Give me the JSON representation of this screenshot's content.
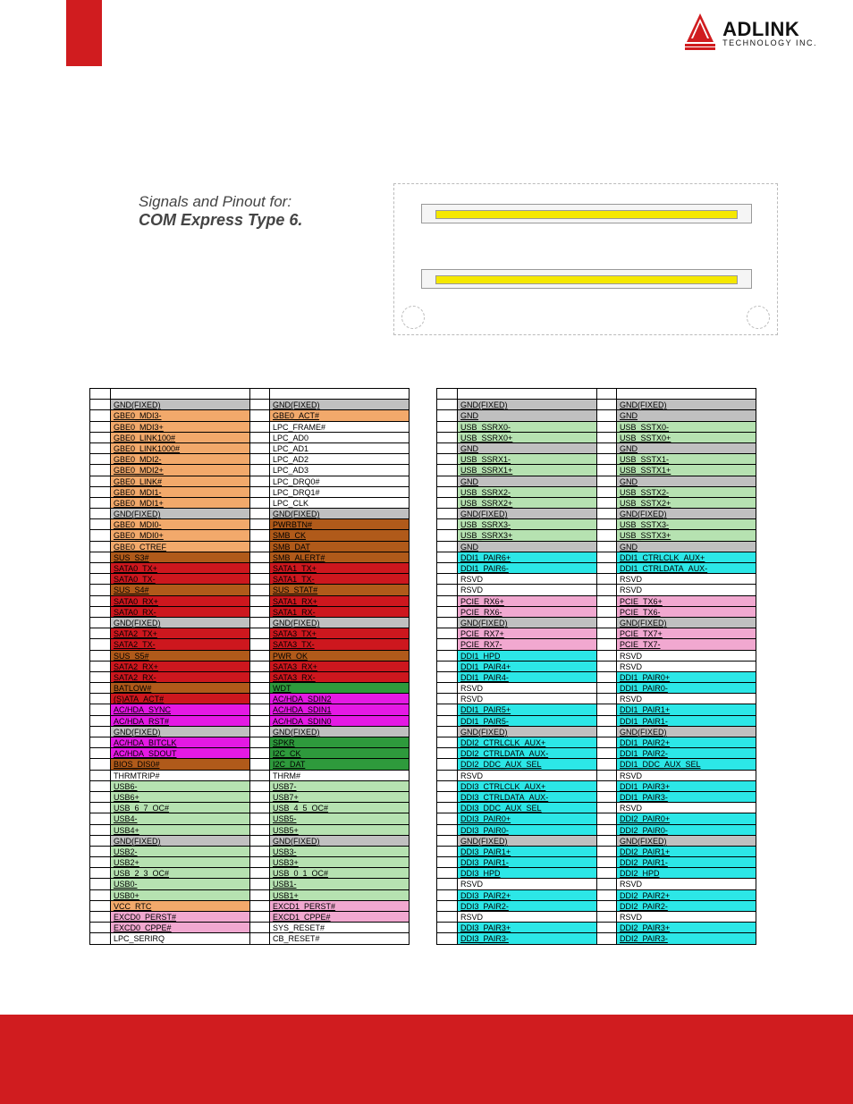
{
  "logo": {
    "main": "ADLINK",
    "sub": "TECHNOLOGY INC."
  },
  "title": {
    "line1": "Signals and Pinout for:",
    "line2": "COM Express Type 6."
  },
  "colors": {
    "gray": "#c0c0c0",
    "orange": "#f2a96b",
    "brown": "#b05a1a",
    "red": "#cd171e",
    "magenta": "#e419e4",
    "green": "#2e9a3c",
    "lgreen": "#b6e2b1",
    "pink": "#f1a8d0",
    "cyan": "#2ce7e7",
    "white": "#ffffff"
  },
  "columns": {
    "A": [
      {
        "sig": "",
        "c": "white"
      },
      {
        "sig": "GND(FIXED)",
        "c": "gray"
      },
      {
        "sig": "GBE0_MDI3-",
        "c": "orange"
      },
      {
        "sig": "GBE0_MDI3+",
        "c": "orange"
      },
      {
        "sig": "GBE0_LINK100#",
        "c": "orange"
      },
      {
        "sig": "GBE0_LINK1000#",
        "c": "orange"
      },
      {
        "sig": "GBE0_MDI2-",
        "c": "orange"
      },
      {
        "sig": "GBE0_MDI2+",
        "c": "orange"
      },
      {
        "sig": "GBE0_LINK#",
        "c": "orange"
      },
      {
        "sig": "GBE0_MDI1-",
        "c": "orange"
      },
      {
        "sig": "GBE0_MDI1+",
        "c": "orange"
      },
      {
        "sig": "GND(FIXED)",
        "c": "gray"
      },
      {
        "sig": "GBE0_MDI0-",
        "c": "orange"
      },
      {
        "sig": "GBE0_MDI0+",
        "c": "orange"
      },
      {
        "sig": "GBE0_CTREF",
        "c": "orange"
      },
      {
        "sig": "SUS_S3#",
        "c": "brown"
      },
      {
        "sig": "SATA0_TX+",
        "c": "red"
      },
      {
        "sig": "SATA0_TX-",
        "c": "red"
      },
      {
        "sig": "SUS_S4#",
        "c": "brown"
      },
      {
        "sig": "SATA0_RX+",
        "c": "red"
      },
      {
        "sig": "SATA0_RX-",
        "c": "red"
      },
      {
        "sig": "GND(FIXED)",
        "c": "gray"
      },
      {
        "sig": "SATA2_TX+",
        "c": "red"
      },
      {
        "sig": "SATA2_TX-",
        "c": "red"
      },
      {
        "sig": "SUS_S5#",
        "c": "brown"
      },
      {
        "sig": "SATA2_RX+",
        "c": "red"
      },
      {
        "sig": "SATA2_RX-",
        "c": "red"
      },
      {
        "sig": "BATLOW#",
        "c": "brown"
      },
      {
        "sig": "(S)ATA_ACT#",
        "c": "red"
      },
      {
        "sig": "AC/HDA_SYNC",
        "c": "magenta"
      },
      {
        "sig": "AC/HDA_RST#",
        "c": "magenta"
      },
      {
        "sig": "GND(FIXED)",
        "c": "gray"
      },
      {
        "sig": "AC/HDA_BITCLK",
        "c": "magenta"
      },
      {
        "sig": "AC/HDA_SDOUT",
        "c": "magenta"
      },
      {
        "sig": "BIOS_DIS0#",
        "c": "brown"
      },
      {
        "sig": "THRMTRIP#",
        "c": "white"
      },
      {
        "sig": "USB6-",
        "c": "lgreen"
      },
      {
        "sig": "USB6+",
        "c": "lgreen"
      },
      {
        "sig": "USB_6_7_OC#",
        "c": "lgreen"
      },
      {
        "sig": "USB4-",
        "c": "lgreen"
      },
      {
        "sig": "USB4+",
        "c": "lgreen"
      },
      {
        "sig": "GND(FIXED)",
        "c": "gray"
      },
      {
        "sig": "USB2-",
        "c": "lgreen"
      },
      {
        "sig": "USB2+",
        "c": "lgreen"
      },
      {
        "sig": "USB_2_3_OC#",
        "c": "lgreen"
      },
      {
        "sig": "USB0-",
        "c": "lgreen"
      },
      {
        "sig": "USB0+",
        "c": "lgreen"
      },
      {
        "sig": "VCC_RTC",
        "c": "orange"
      },
      {
        "sig": "EXCD0_PERST#",
        "c": "pink"
      },
      {
        "sig": "EXCD0_CPPE#",
        "c": "pink"
      },
      {
        "sig": "LPC_SERIRQ",
        "c": "white"
      }
    ],
    "B": [
      {
        "sig": "",
        "c": "white"
      },
      {
        "sig": "GND(FIXED)",
        "c": "gray"
      },
      {
        "sig": "GBE0_ACT#",
        "c": "orange"
      },
      {
        "sig": "LPC_FRAME#",
        "c": "white"
      },
      {
        "sig": "LPC_AD0",
        "c": "white"
      },
      {
        "sig": "LPC_AD1",
        "c": "white"
      },
      {
        "sig": "LPC_AD2",
        "c": "white"
      },
      {
        "sig": "LPC_AD3",
        "c": "white"
      },
      {
        "sig": "LPC_DRQ0#",
        "c": "white"
      },
      {
        "sig": "LPC_DRQ1#",
        "c": "white"
      },
      {
        "sig": "LPC_CLK",
        "c": "white"
      },
      {
        "sig": "GND(FIXED)",
        "c": "gray"
      },
      {
        "sig": "PWRBTN#",
        "c": "brown"
      },
      {
        "sig": "SMB_CK",
        "c": "brown"
      },
      {
        "sig": "SMB_DAT",
        "c": "brown"
      },
      {
        "sig": "SMB_ALERT#",
        "c": "brown"
      },
      {
        "sig": "SATA1_TX+",
        "c": "red"
      },
      {
        "sig": "SATA1_TX-",
        "c": "red"
      },
      {
        "sig": "SUS_STAT#",
        "c": "brown"
      },
      {
        "sig": "SATA1_RX+",
        "c": "red"
      },
      {
        "sig": "SATA1_RX-",
        "c": "red"
      },
      {
        "sig": "GND(FIXED)",
        "c": "gray"
      },
      {
        "sig": "SATA3_TX+",
        "c": "red"
      },
      {
        "sig": "SATA3_TX-",
        "c": "red"
      },
      {
        "sig": "PWR_OK",
        "c": "brown"
      },
      {
        "sig": "SATA3_RX+",
        "c": "red"
      },
      {
        "sig": "SATA3_RX-",
        "c": "red"
      },
      {
        "sig": "WDT",
        "c": "green"
      },
      {
        "sig": "AC/HDA_SDIN2",
        "c": "magenta"
      },
      {
        "sig": "AC/HDA_SDIN1",
        "c": "magenta"
      },
      {
        "sig": "AC/HDA_SDIN0",
        "c": "magenta"
      },
      {
        "sig": "GND(FIXED)",
        "c": "gray"
      },
      {
        "sig": "SPKR",
        "c": "green"
      },
      {
        "sig": "I2C_CK",
        "c": "green"
      },
      {
        "sig": "I2C_DAT",
        "c": "green"
      },
      {
        "sig": "THRM#",
        "c": "white"
      },
      {
        "sig": "USB7-",
        "c": "lgreen"
      },
      {
        "sig": "USB7+",
        "c": "lgreen"
      },
      {
        "sig": "USB_4_5_OC#",
        "c": "lgreen"
      },
      {
        "sig": "USB5-",
        "c": "lgreen"
      },
      {
        "sig": "USB5+",
        "c": "lgreen"
      },
      {
        "sig": "GND(FIXED)",
        "c": "gray"
      },
      {
        "sig": "USB3-",
        "c": "lgreen"
      },
      {
        "sig": "USB3+",
        "c": "lgreen"
      },
      {
        "sig": "USB_0_1_OC#",
        "c": "lgreen"
      },
      {
        "sig": "USB1-",
        "c": "lgreen"
      },
      {
        "sig": "USB1+",
        "c": "lgreen"
      },
      {
        "sig": "EXCD1_PERST#",
        "c": "pink"
      },
      {
        "sig": "EXCD1_CPPE#",
        "c": "pink"
      },
      {
        "sig": "SYS_RESET#",
        "c": "white"
      },
      {
        "sig": "CB_RESET#",
        "c": "white"
      }
    ],
    "C": [
      {
        "sig": "",
        "c": "white"
      },
      {
        "sig": "GND(FIXED)",
        "c": "gray"
      },
      {
        "sig": "GND",
        "c": "gray"
      },
      {
        "sig": "USB_SSRX0-",
        "c": "lgreen"
      },
      {
        "sig": "USB_SSRX0+",
        "c": "lgreen"
      },
      {
        "sig": "GND",
        "c": "gray"
      },
      {
        "sig": "USB_SSRX1-",
        "c": "lgreen"
      },
      {
        "sig": "USB_SSRX1+",
        "c": "lgreen"
      },
      {
        "sig": "GND",
        "c": "gray"
      },
      {
        "sig": "USB_SSRX2-",
        "c": "lgreen"
      },
      {
        "sig": "USB_SSRX2+",
        "c": "lgreen"
      },
      {
        "sig": "GND(FIXED)",
        "c": "gray"
      },
      {
        "sig": "USB_SSRX3-",
        "c": "lgreen"
      },
      {
        "sig": "USB_SSRX3+",
        "c": "lgreen"
      },
      {
        "sig": "GND",
        "c": "gray"
      },
      {
        "sig": "DDI1_PAIR6+",
        "c": "cyan"
      },
      {
        "sig": "DDI1_PAIR6-",
        "c": "cyan"
      },
      {
        "sig": "RSVD",
        "c": "white"
      },
      {
        "sig": "RSVD",
        "c": "white"
      },
      {
        "sig": "PCIE_RX6+",
        "c": "pink"
      },
      {
        "sig": "PCIE_RX6-",
        "c": "pink"
      },
      {
        "sig": "GND(FIXED)",
        "c": "gray"
      },
      {
        "sig": "PCIE_RX7+",
        "c": "pink"
      },
      {
        "sig": "PCIE_RX7-",
        "c": "pink"
      },
      {
        "sig": "DDI1_HPD",
        "c": "cyan"
      },
      {
        "sig": "DDI1_PAIR4+",
        "c": "cyan"
      },
      {
        "sig": "DDI1_PAIR4-",
        "c": "cyan"
      },
      {
        "sig": "RSVD",
        "c": "white"
      },
      {
        "sig": "RSVD",
        "c": "white"
      },
      {
        "sig": "DDI1_PAIR5+",
        "c": "cyan"
      },
      {
        "sig": "DDI1_PAIR5-",
        "c": "cyan"
      },
      {
        "sig": "GND(FIXED)",
        "c": "gray"
      },
      {
        "sig": "DDI2_CTRLCLK_AUX+",
        "c": "cyan"
      },
      {
        "sig": "DDI2_CTRLDATA_AUX-",
        "c": "cyan"
      },
      {
        "sig": "DDI2_DDC_AUX_SEL",
        "c": "cyan"
      },
      {
        "sig": "RSVD",
        "c": "white"
      },
      {
        "sig": "DDI3_CTRLCLK_AUX+",
        "c": "cyan"
      },
      {
        "sig": "DDI3_CTRLDATA_AUX-",
        "c": "cyan"
      },
      {
        "sig": "DDI3_DDC_AUX_SEL",
        "c": "cyan"
      },
      {
        "sig": "DDI3_PAIR0+",
        "c": "cyan"
      },
      {
        "sig": "DDI3_PAIR0-",
        "c": "cyan"
      },
      {
        "sig": "GND(FIXED)",
        "c": "gray"
      },
      {
        "sig": "DDI3_PAIR1+",
        "c": "cyan"
      },
      {
        "sig": "DDI3_PAIR1-",
        "c": "cyan"
      },
      {
        "sig": "DDI3_HPD",
        "c": "cyan"
      },
      {
        "sig": "RSVD",
        "c": "white"
      },
      {
        "sig": "DDI3_PAIR2+",
        "c": "cyan"
      },
      {
        "sig": "DDI3_PAIR2-",
        "c": "cyan"
      },
      {
        "sig": "RSVD",
        "c": "white"
      },
      {
        "sig": "DDI3_PAIR3+",
        "c": "cyan"
      },
      {
        "sig": "DDI3_PAIR3-",
        "c": "cyan"
      }
    ],
    "D": [
      {
        "sig": "",
        "c": "white"
      },
      {
        "sig": "GND(FIXED)",
        "c": "gray"
      },
      {
        "sig": "GND",
        "c": "gray"
      },
      {
        "sig": "USB_SSTX0-",
        "c": "lgreen"
      },
      {
        "sig": "USB_SSTX0+",
        "c": "lgreen"
      },
      {
        "sig": "GND",
        "c": "gray"
      },
      {
        "sig": "USB_SSTX1-",
        "c": "lgreen"
      },
      {
        "sig": "USB_SSTX1+",
        "c": "lgreen"
      },
      {
        "sig": "GND",
        "c": "gray"
      },
      {
        "sig": "USB_SSTX2-",
        "c": "lgreen"
      },
      {
        "sig": "USB_SSTX2+",
        "c": "lgreen"
      },
      {
        "sig": "GND(FIXED)",
        "c": "gray"
      },
      {
        "sig": "USB_SSTX3-",
        "c": "lgreen"
      },
      {
        "sig": "USB_SSTX3+",
        "c": "lgreen"
      },
      {
        "sig": "GND",
        "c": "gray"
      },
      {
        "sig": "DDI1_CTRLCLK_AUX+",
        "c": "cyan"
      },
      {
        "sig": "DDI1_CTRLDATA_AUX-",
        "c": "cyan"
      },
      {
        "sig": "RSVD",
        "c": "white"
      },
      {
        "sig": "RSVD",
        "c": "white"
      },
      {
        "sig": "PCIE_TX6+",
        "c": "pink"
      },
      {
        "sig": "PCIE_TX6-",
        "c": "pink"
      },
      {
        "sig": "GND(FIXED)",
        "c": "gray"
      },
      {
        "sig": "PCIE_TX7+",
        "c": "pink"
      },
      {
        "sig": "PCIE_TX7-",
        "c": "pink"
      },
      {
        "sig": "RSVD",
        "c": "white"
      },
      {
        "sig": "RSVD",
        "c": "white"
      },
      {
        "sig": "DDI1_PAIR0+",
        "c": "cyan"
      },
      {
        "sig": "DDI1_PAIR0-",
        "c": "cyan"
      },
      {
        "sig": "RSVD",
        "c": "white"
      },
      {
        "sig": "DDI1_PAIR1+",
        "c": "cyan"
      },
      {
        "sig": "DDI1_PAIR1-",
        "c": "cyan"
      },
      {
        "sig": "GND(FIXED)",
        "c": "gray"
      },
      {
        "sig": "DDI1_PAIR2+",
        "c": "cyan"
      },
      {
        "sig": "DDI1_PAIR2-",
        "c": "cyan"
      },
      {
        "sig": "DDI1_DDC_AUX_SEL",
        "c": "cyan"
      },
      {
        "sig": "RSVD",
        "c": "white"
      },
      {
        "sig": "DDI1_PAIR3+",
        "c": "cyan"
      },
      {
        "sig": "DDI1_PAIR3-",
        "c": "cyan"
      },
      {
        "sig": "RSVD",
        "c": "white"
      },
      {
        "sig": "DDI2_PAIR0+",
        "c": "cyan"
      },
      {
        "sig": "DDI2_PAIR0-",
        "c": "cyan"
      },
      {
        "sig": "GND(FIXED)",
        "c": "gray"
      },
      {
        "sig": "DDI2_PAIR1+",
        "c": "cyan"
      },
      {
        "sig": "DDI2_PAIR1-",
        "c": "cyan"
      },
      {
        "sig": "DDI2_HPD",
        "c": "cyan"
      },
      {
        "sig": "RSVD",
        "c": "white"
      },
      {
        "sig": "DDI2_PAIR2+",
        "c": "cyan"
      },
      {
        "sig": "DDI2_PAIR2-",
        "c": "cyan"
      },
      {
        "sig": "RSVD",
        "c": "white"
      },
      {
        "sig": "DDI2_PAIR3+",
        "c": "cyan"
      },
      {
        "sig": "DDI2_PAIR3-",
        "c": "cyan"
      }
    ]
  }
}
